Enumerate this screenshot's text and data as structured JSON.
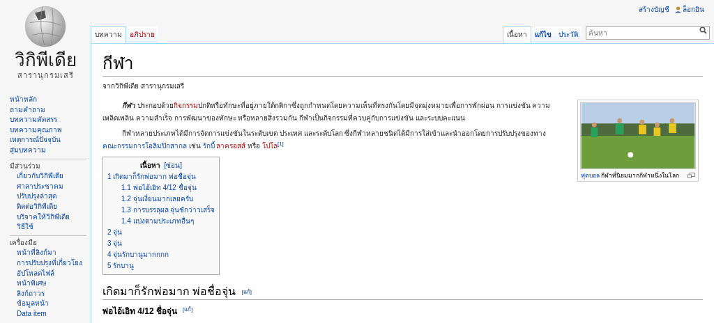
{
  "personal": [
    "สร้างบัญชี",
    "ล็อกอิน"
  ],
  "logo": {
    "title": "วิกิพีเดีย",
    "tagline": "สารานุกรมเสรี"
  },
  "sidebar": {
    "main": [
      "หน้าหลัก",
      "ถามคำถาม",
      "บทความคัดสรร",
      "บทความคุณภาพ",
      "เหตุการณ์ปัจจุบัน",
      "สุ่มบทความ"
    ],
    "sections": [
      {
        "heading": "มีส่วนร่วม",
        "items": [
          "เกี่ยวกับวิกิพีเดีย",
          "ศาลาประชาคม",
          "ปรับปรุงล่าสุด",
          "ติดต่อวิกิพีเดีย",
          "บริจาคให้วิกิพีเดีย",
          "วิธีใช้"
        ]
      },
      {
        "heading": "เครื่องมือ",
        "items": [
          "หน้าที่ลิงก์มา",
          "การปรับปรุงที่เกี่ยวโยง",
          "อัปโหลดไฟล์",
          "หน้าพิเศษ",
          "ลิงก์ถาวร",
          "ข้อมูลหน้า",
          "Data item"
        ]
      }
    ]
  },
  "left_tabs": [
    {
      "label": "บทความ",
      "selected": true,
      "kind": "page"
    },
    {
      "label": "อภิปราย",
      "selected": false,
      "kind": "redlink"
    }
  ],
  "right_tabs": [
    {
      "label": "เนื้อหา",
      "selected": true
    },
    {
      "label": "แก้ไข",
      "selected": false
    },
    {
      "label": "ประวัติ",
      "selected": false
    }
  ],
  "search": {
    "placeholder": "ค้นหา"
  },
  "title": "กีฬา",
  "subtitle": "จากวิกิพีเดีย สารานุกรมเสรี",
  "paragraphs": [
    [
      {
        "kind": "bold",
        "text": "กีฬา"
      },
      {
        "kind": "text",
        "text": " ประกอบด้วย"
      },
      {
        "kind": "redlink",
        "text": "กิจกรรม"
      },
      {
        "kind": "text",
        "text": "ปกติหรือทักษะที่อยู่ภายใต้กติกาซึ่งถูกกำหนดโดยความเห็นที่ตรงกันโดยมีจุดมุ่งหมายเพื่อการพักผ่อน การแข่งขัน ความเพลิดเพลิน ความสำเร็จ การพัฒนาของทักษะ หรือหลายสิ่งรวมกัน กีฬาเป็นกิจกรรมที่ควบคู่กับการแข่งขัน และระบบคะแนน"
      }
    ],
    [
      {
        "kind": "text",
        "text": "กีฬาหลายประเภทได้มีการจัดการแข่งขันในระดับเขต ประเทศ และระดับโลก ซึ่งกีฬาหลายชนิดได้มีการใส่เข้าและนำออกโดยการปรับปรุงของทาง"
      },
      {
        "kind": "link",
        "text": "คณะกรรมการโอลิมปิกสากล"
      },
      {
        "kind": "text",
        "text": " เช่น "
      },
      {
        "kind": "link",
        "text": "รักบี้"
      },
      {
        "kind": "redlink",
        "text": "ลาครอสส์"
      },
      {
        "kind": "text",
        "text": " หรือ "
      },
      {
        "kind": "redlink",
        "text": "โปโล"
      },
      {
        "kind": "ref",
        "text": "[1]"
      }
    ]
  ],
  "toc": {
    "title": "เนื้อหา",
    "toggle": "[ซ่อน]",
    "items": [
      {
        "number": "1",
        "label": "เกิดมาก็รักพ่อมาก พ่อชื่อจุ่น",
        "children": [
          {
            "number": "1.1",
            "label": "พ่อไอ้เอิท 4/12 ชื่อจุ่น"
          },
          {
            "number": "1.2",
            "label": "จุ่นเงี่ยนมากเลยครับ"
          },
          {
            "number": "1.3",
            "label": "การบรรลุผล จุ่นชักว่าวเสร็จ"
          },
          {
            "number": "1.4",
            "label": "แบ่งตามประเภทอื่นๆ"
          }
        ]
      },
      {
        "number": "2",
        "label": "จุ่น"
      },
      {
        "number": "3",
        "label": "จุ่น"
      },
      {
        "number": "4",
        "label": "จุ่นรักบานูมากกกก"
      },
      {
        "number": "5",
        "label": "รักบานู"
      }
    ]
  },
  "thumb": {
    "kind": "picture",
    "caption_link": "ฟุตบอล",
    "caption": " กีฬาที่นิยมมากกีฬาหนึ่งในโลก"
  },
  "sections": [
    {
      "heading": "เกิดมาก็รักพ่อมาก พ่อชื่อจุ่น",
      "edit": "[แก้]",
      "kind": "h2"
    },
    {
      "heading": "พ่อไอ้เอิท 4/12 ชื่อจุ่น",
      "edit": "[แก้]",
      "kind": "h3"
    }
  ]
}
